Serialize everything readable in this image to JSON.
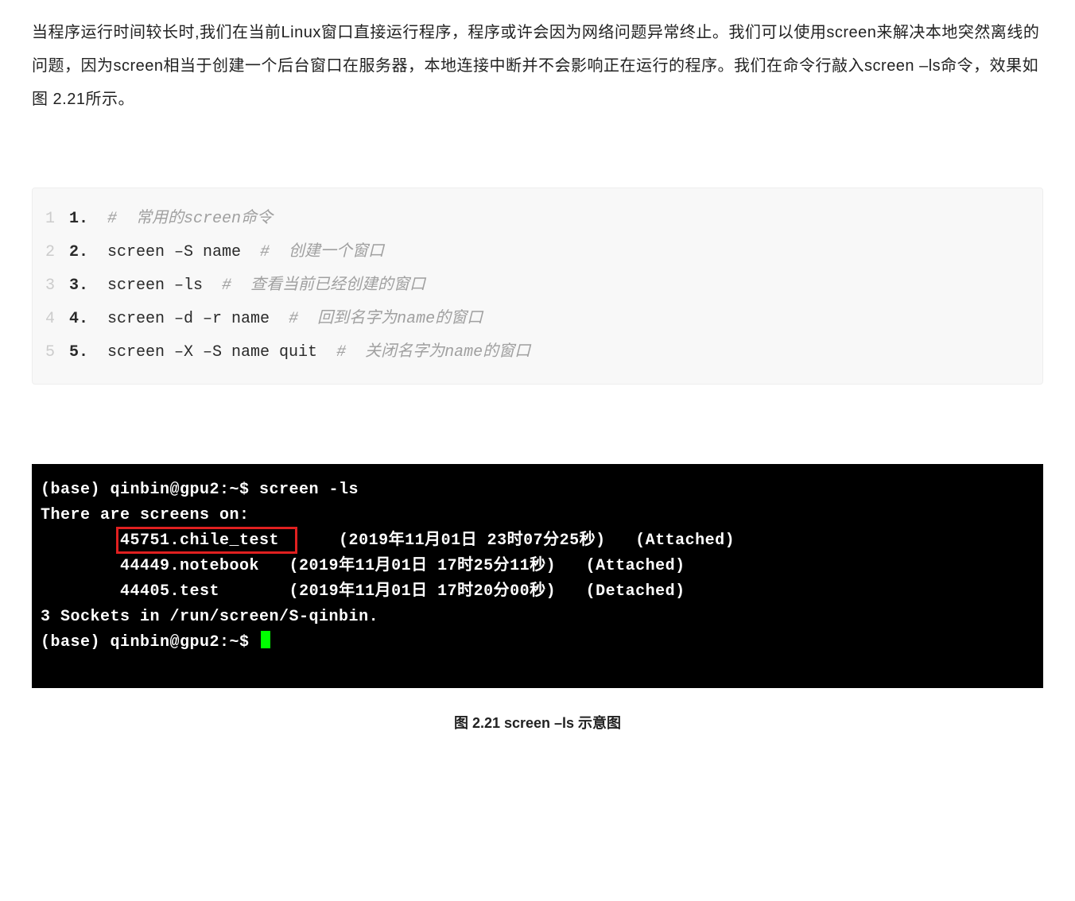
{
  "paragraph": "当程序运行时间较长时,我们在当前Linux窗口直接运行程序，程序或许会因为网络问题异常终止。我们可以使用screen来解决本地突然离线的问题，因为screen相当于创建一个后台窗口在服务器，本地连接中断并不会影响正在运行的程序。我们在命令行敲入screen –ls命令，效果如图 2.21所示。",
  "code": {
    "lines": [
      {
        "g": "1",
        "num": "1.",
        "text": "",
        "comment": "#  常用的screen命令"
      },
      {
        "g": "2",
        "num": "2.",
        "text": "screen –S name  ",
        "comment": "#  创建一个窗口"
      },
      {
        "g": "3",
        "num": "3.",
        "text": "screen –ls  ",
        "comment": "#  查看当前已经创建的窗口"
      },
      {
        "g": "4",
        "num": "4.",
        "text": "screen –d –r name  ",
        "comment": "#  回到名字为name的窗口"
      },
      {
        "g": "5",
        "num": "5.",
        "text": "screen –X –S name quit  ",
        "comment": "#  关闭名字为name的窗口"
      }
    ]
  },
  "terminal": {
    "prompt1": "(base) qinbin@gpu2:~$ screen -ls",
    "header": "There are screens on:",
    "rows": [
      {
        "name": "        45751.chile_test",
        "date": "      (2019年11月01日 23时07分25秒)   (Attached)",
        "highlight": true
      },
      {
        "name": "        44449.notebook",
        "date": "   (2019年11月01日 17时25分11秒)   (Attached)",
        "highlight": false
      },
      {
        "name": "        44405.test",
        "date": "       (2019年11月01日 17时20分00秒)   (Detached)",
        "highlight": false
      }
    ],
    "footer": "3 Sockets in /run/screen/S-qinbin.",
    "prompt2": "(base) qinbin@gpu2:~$ "
  },
  "caption": "图 2.21 screen –ls 示意图"
}
